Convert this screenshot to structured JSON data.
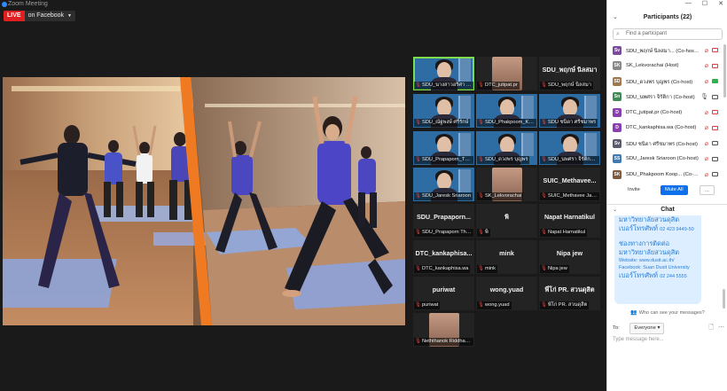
{
  "window": {
    "title": "Zoom Meeting"
  },
  "live": {
    "badge": "LIVE",
    "platform": "on Facebook"
  },
  "share": {
    "description": ""
  },
  "gallery": [
    {
      "name": "SDU_นางสาวอริศา คำใส",
      "type": "cam",
      "active": true
    },
    {
      "name": "DTC_jutipat.pr",
      "type": "photo"
    },
    {
      "name": "SDU_พฤกษ์ นิลสมา",
      "big": "SDU_พฤกษ์ นิลสมา",
      "type": "name"
    },
    {
      "name": "SDU_ณัฐพงษ์ ศรีรักษ์",
      "type": "cam"
    },
    {
      "name": "SDU_Phakpoom_Koop",
      "type": "cam"
    },
    {
      "name": "SDU ชนิดา ศรีชมาพร",
      "type": "cam"
    },
    {
      "name": "SDU_Prapaporn_Thon",
      "type": "cam"
    },
    {
      "name": "SDU_ดวงพร บุญพร",
      "type": "cam"
    },
    {
      "name": "SDU_นพศรา จิรัติกานนท์",
      "type": "cam"
    },
    {
      "name": "SDU_Jaresk Sriaroon",
      "type": "cam"
    },
    {
      "name": "SK_Lekvorachai",
      "type": "photo"
    },
    {
      "name": "SUIC_Methavee Jaibu",
      "big": "SUIC_Methavee...",
      "type": "name"
    },
    {
      "name": "SDU_Prapaporn Thon",
      "big": "SDU_Prapaporn...",
      "type": "name"
    },
    {
      "name": "พิ",
      "big": "พิ",
      "type": "name"
    },
    {
      "name": "Napat Harnatikul",
      "big": "Napat Harnatikul",
      "type": "name"
    },
    {
      "name": "DTC_kankaphisa.wa",
      "big": "DTC_kankaphisa...",
      "type": "name"
    },
    {
      "name": "mink",
      "big": "mink",
      "type": "name"
    },
    {
      "name": "Nipa jew",
      "big": "Nipa jew",
      "type": "name"
    },
    {
      "name": "puriwat",
      "big": "puriwat",
      "type": "name"
    },
    {
      "name": "wong.yuad",
      "big": "wong.yuad",
      "type": "name"
    },
    {
      "name": "พี่โก่ PR. สวนดุสิต",
      "big": "พี่โก่ PR. สวนดุสิต",
      "type": "name"
    },
    {
      "name": "Neththanok Riddhagni",
      "type": "photo"
    }
  ],
  "panel": {
    "title": "Participants (22)",
    "search_placeholder": "Find a participant",
    "participants": [
      {
        "initials": "Sv",
        "color": "#7a4b9b",
        "name": "SDU_พฤกษ์ นิลสมา...  (Co-host, me)",
        "mic": "muted",
        "video": "muted"
      },
      {
        "initials": "SK",
        "color": "#888888",
        "name": "SK_Lekvorachai (Host)",
        "mic": "muted",
        "video": "muted"
      },
      {
        "initials": "SD",
        "color": "#a07850",
        "name": "SDU_ดวงพร บุญพร (Co-host)",
        "mic": "muted",
        "video": "green"
      },
      {
        "initials": "Sn",
        "color": "#3f8a55",
        "name": "SDU_นพศรา จิรัติกา (Co-host)",
        "mic": "on",
        "video": "on"
      },
      {
        "initials": "D",
        "color": "#8a3fb0",
        "name": "DTC_jutipat.pr (Co-host)",
        "mic": "muted",
        "video": "muted"
      },
      {
        "initials": "D",
        "color": "#8a3fb0",
        "name": "DTC_kankaphisa.wa (Co-host)",
        "mic": "muted",
        "video": "muted"
      },
      {
        "initials": "Sv",
        "color": "#5a5a6a",
        "name": "SDU ชนิดา ศรีชมาพร (Co-host)",
        "mic": "muted",
        "video": "on"
      },
      {
        "initials": "SS",
        "color": "#3f7ab0",
        "name": "SDU_Jaresk Sriaroon (Co-host)",
        "mic": "muted",
        "video": "on"
      },
      {
        "initials": "SK",
        "color": "#7a5a40",
        "name": "SDU_Phakpoom Koop... (Co-host)",
        "mic": "muted",
        "video": "on"
      }
    ],
    "invite": "Invite",
    "mute_all": "Mute All",
    "more": "...",
    "chat_title": "Chat",
    "chat": {
      "line1": "มหาวิทยาลัยสวนดุสิต",
      "line2": "เบอร์โทรศัพท์",
      "num1": "02 423 9449-50",
      "line3": "ช่องทางการติดต่อ",
      "line4": "มหาวิทยาลัยสวนดุสิต",
      "web": "Website: www.dusit.ac.th/",
      "fb": "Facebook: Suan Dusit University",
      "line5": "เบอร์โทรศัพท์",
      "num2": "02 244 5555"
    },
    "who_can_see": "Who can see your messages?",
    "to_label": "To:",
    "to_value": "Everyone",
    "message_placeholder": "Type message here..."
  }
}
